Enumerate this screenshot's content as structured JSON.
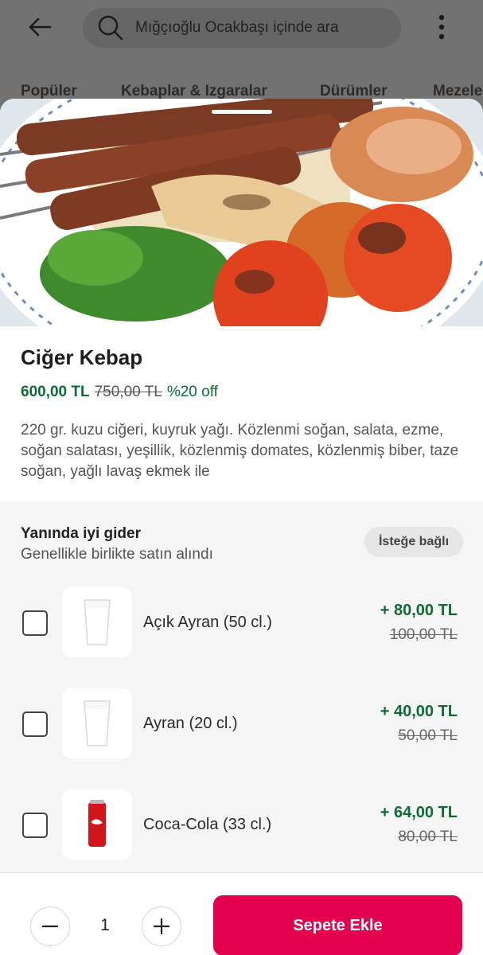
{
  "header": {
    "search_placeholder": "Mığçıoğlu Ocakbaşı içinde ara"
  },
  "tabs": [
    {
      "label": "Popüler"
    },
    {
      "label": "Kebaplar & Izgaralar"
    },
    {
      "label": "Dürümler"
    },
    {
      "label": "Mezeler"
    }
  ],
  "product": {
    "name": "Ciğer Kebap",
    "price": "600,00 TL",
    "old_price": "750,00 TL",
    "discount": "%20 off",
    "description": "220 gr. kuzu ciğeri, kuyruk yağı. Közlenmi soğan, salata, ezme, soğan salatası, yeşillik, közlenmiş domates, közlenmiş biber, taze soğan, yağlı lavaş ekmek ile"
  },
  "addons": {
    "title": "Yanında iyi gider",
    "subtitle": "Genellikle birlikte satın alındı",
    "badge": "İsteğe bağlı",
    "items": [
      {
        "name": "Açık Ayran (50 cl.)",
        "price": "+ 80,00 TL",
        "old_price": "100,00 TL",
        "icon": "ayran-glass-icon"
      },
      {
        "name": "Ayran (20 cl.)",
        "price": "+ 40,00 TL",
        "old_price": "50,00 TL",
        "icon": "ayran-glass-icon"
      },
      {
        "name": "Coca-Cola (33 cl.)",
        "price": "+ 64,00 TL",
        "old_price": "80,00 TL",
        "icon": "cola-can-icon"
      }
    ]
  },
  "cart": {
    "quantity": "1",
    "add_label": "Sepete Ekle"
  },
  "colors": {
    "accent": "#e5004f",
    "price_green": "#0e6b35"
  }
}
